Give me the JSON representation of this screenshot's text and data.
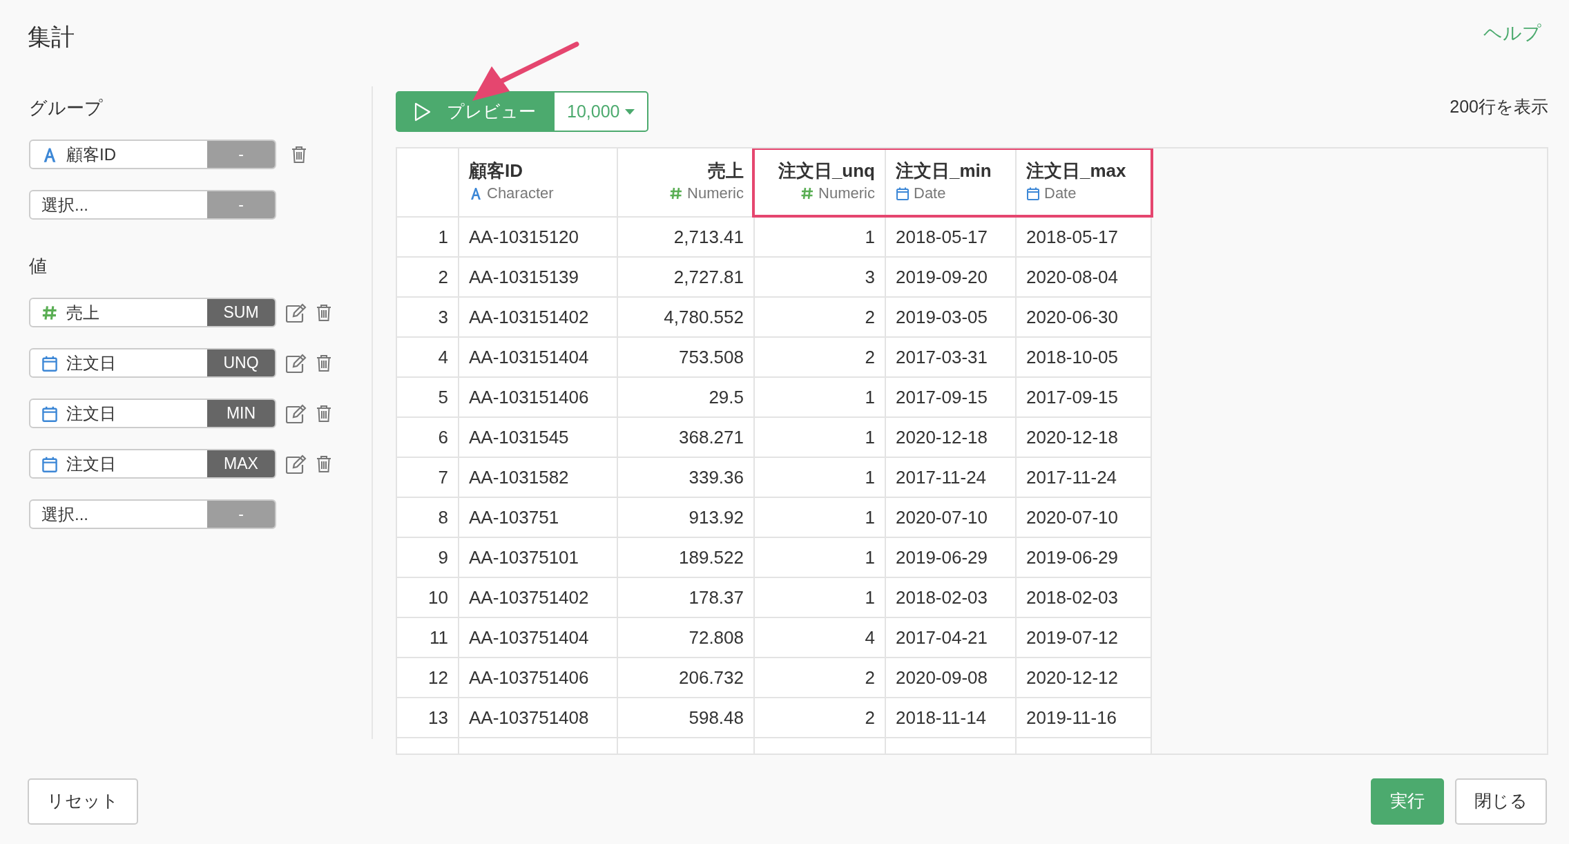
{
  "title": "集計",
  "help_link": "ヘルプ",
  "group": {
    "label": "グループ",
    "items": [
      {
        "kind": "character",
        "name": "顧客ID",
        "agg": "-",
        "agg_active": false,
        "editable": false,
        "deletable": true
      },
      {
        "kind": "select",
        "placeholder": "選択...",
        "agg": "-",
        "agg_active": false,
        "editable": false,
        "deletable": false
      }
    ]
  },
  "values": {
    "label": "値",
    "items": [
      {
        "kind": "numeric",
        "name": "売上",
        "agg": "SUM",
        "agg_active": true,
        "editable": true,
        "deletable": true
      },
      {
        "kind": "date",
        "name": "注文日",
        "agg": "UNQ",
        "agg_active": true,
        "editable": true,
        "deletable": true
      },
      {
        "kind": "date",
        "name": "注文日",
        "agg": "MIN",
        "agg_active": true,
        "editable": true,
        "deletable": true
      },
      {
        "kind": "date",
        "name": "注文日",
        "agg": "MAX",
        "agg_active": true,
        "editable": true,
        "deletable": true
      },
      {
        "kind": "select",
        "placeholder": "選択...",
        "agg": "-",
        "agg_active": false,
        "editable": false,
        "deletable": false
      }
    ]
  },
  "preview": {
    "label": "プレビュー",
    "limit": "10,000",
    "arrow_annotation": true
  },
  "row_count": "200行を表示",
  "table": {
    "columns": [
      {
        "name": "顧客ID",
        "kind": "character",
        "type_label": "Character",
        "highlighted": false
      },
      {
        "name": "売上",
        "kind": "numeric",
        "type_label": "Numeric",
        "highlighted": false
      },
      {
        "name": "注文日_unq",
        "kind": "numeric",
        "type_label": "Numeric",
        "highlighted": true
      },
      {
        "name": "注文日_min",
        "kind": "date",
        "type_label": "Date",
        "highlighted": true
      },
      {
        "name": "注文日_max",
        "kind": "date",
        "type_label": "Date",
        "highlighted": true
      }
    ],
    "rows": [
      {
        "index": "1",
        "cells": [
          "AA-10315120",
          "2,713.41",
          "1",
          "2018-05-17",
          "2018-05-17"
        ]
      },
      {
        "index": "2",
        "cells": [
          "AA-10315139",
          "2,727.81",
          "3",
          "2019-09-20",
          "2020-08-04"
        ]
      },
      {
        "index": "3",
        "cells": [
          "AA-103151402",
          "4,780.552",
          "2",
          "2019-03-05",
          "2020-06-30"
        ]
      },
      {
        "index": "4",
        "cells": [
          "AA-103151404",
          "753.508",
          "2",
          "2017-03-31",
          "2018-10-05"
        ]
      },
      {
        "index": "5",
        "cells": [
          "AA-103151406",
          "29.5",
          "1",
          "2017-09-15",
          "2017-09-15"
        ]
      },
      {
        "index": "6",
        "cells": [
          "AA-1031545",
          "368.271",
          "1",
          "2020-12-18",
          "2020-12-18"
        ]
      },
      {
        "index": "7",
        "cells": [
          "AA-1031582",
          "339.36",
          "1",
          "2017-11-24",
          "2017-11-24"
        ]
      },
      {
        "index": "8",
        "cells": [
          "AA-103751",
          "913.92",
          "1",
          "2020-07-10",
          "2020-07-10"
        ]
      },
      {
        "index": "9",
        "cells": [
          "AA-10375101",
          "189.522",
          "1",
          "2019-06-29",
          "2019-06-29"
        ]
      },
      {
        "index": "10",
        "cells": [
          "AA-103751402",
          "178.37",
          "1",
          "2018-02-03",
          "2018-02-03"
        ]
      },
      {
        "index": "11",
        "cells": [
          "AA-103751404",
          "72.808",
          "4",
          "2017-04-21",
          "2019-07-12"
        ]
      },
      {
        "index": "12",
        "cells": [
          "AA-103751406",
          "206.732",
          "2",
          "2020-09-08",
          "2020-12-12"
        ]
      },
      {
        "index": "13",
        "cells": [
          "AA-103751408",
          "598.48",
          "2",
          "2018-11-14",
          "2019-11-16"
        ]
      }
    ]
  },
  "footer": {
    "reset": "リセット",
    "run": "実行",
    "close": "閉じる"
  }
}
